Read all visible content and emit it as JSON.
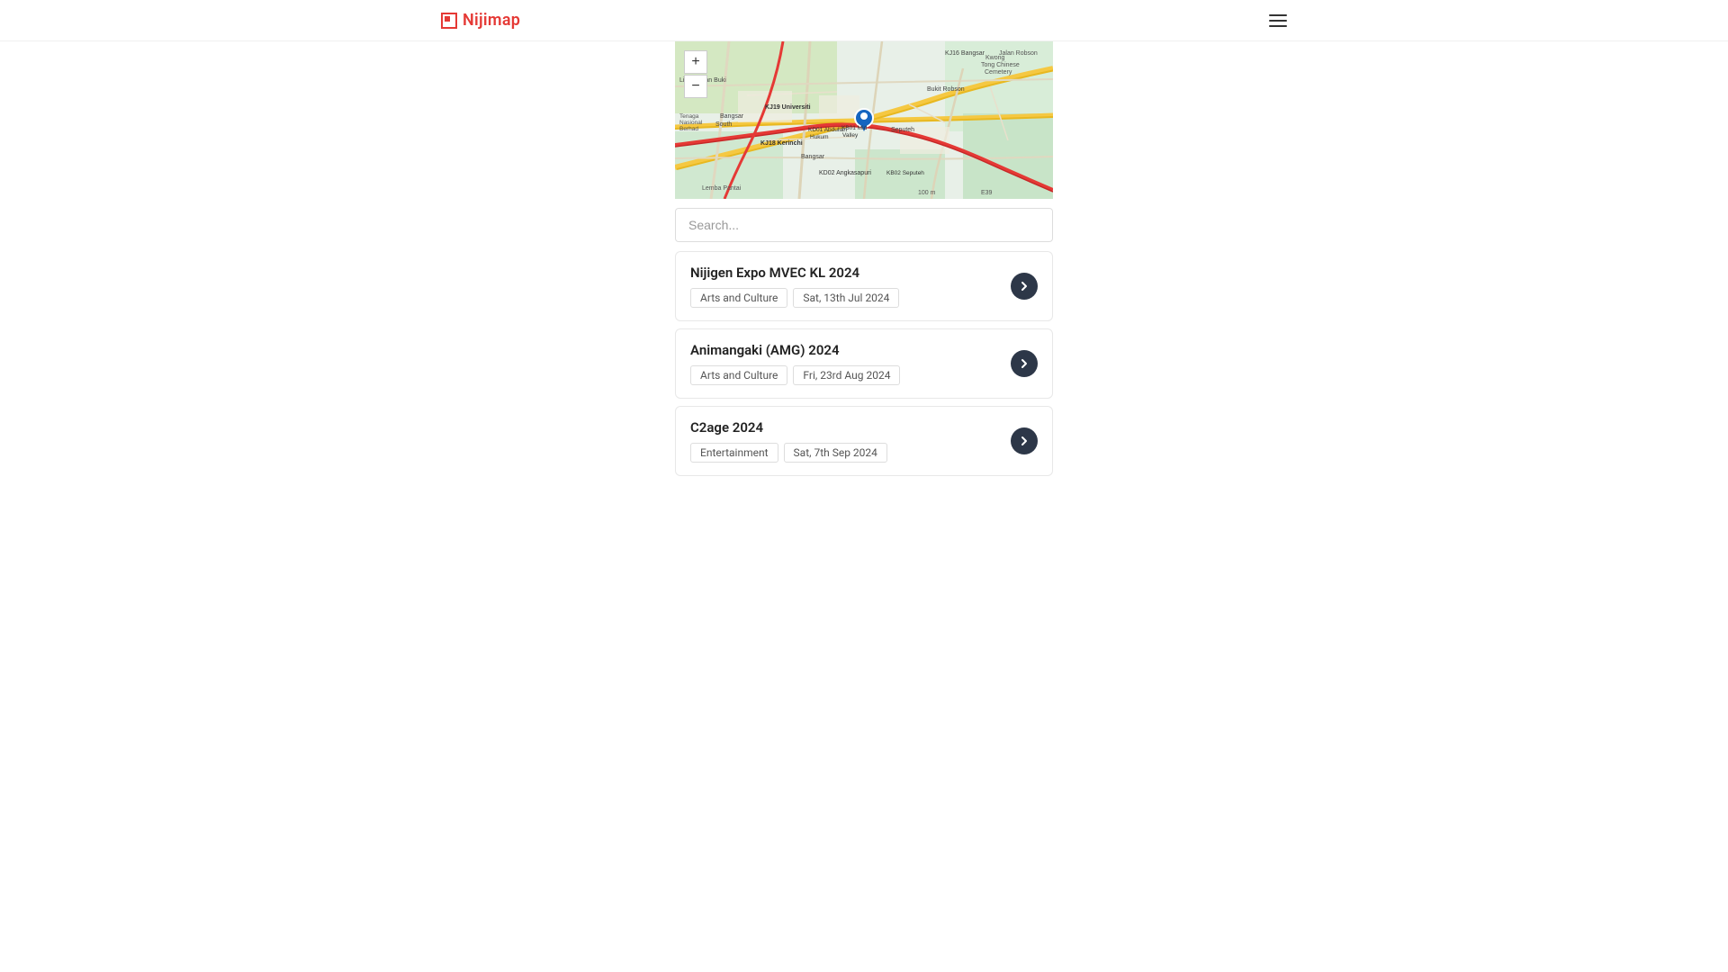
{
  "header": {
    "logo_text": "Nijimap",
    "menu_aria": "Open menu"
  },
  "map": {
    "zoom_in_label": "+",
    "zoom_out_label": "−"
  },
  "search": {
    "placeholder": "Search..."
  },
  "events": [
    {
      "id": 1,
      "title": "Nijigen Expo MVEC KL 2024",
      "category": "Arts and Culture",
      "date": "Sat, 13th Jul 2024"
    },
    {
      "id": 2,
      "title": "Animangaki (AMG) 2024",
      "category": "Arts and Culture",
      "date": "Fri, 23rd Aug 2024"
    },
    {
      "id": 3,
      "title": "C2age 2024",
      "category": "Entertainment",
      "date": "Sat, 7th Sep 2024"
    }
  ]
}
